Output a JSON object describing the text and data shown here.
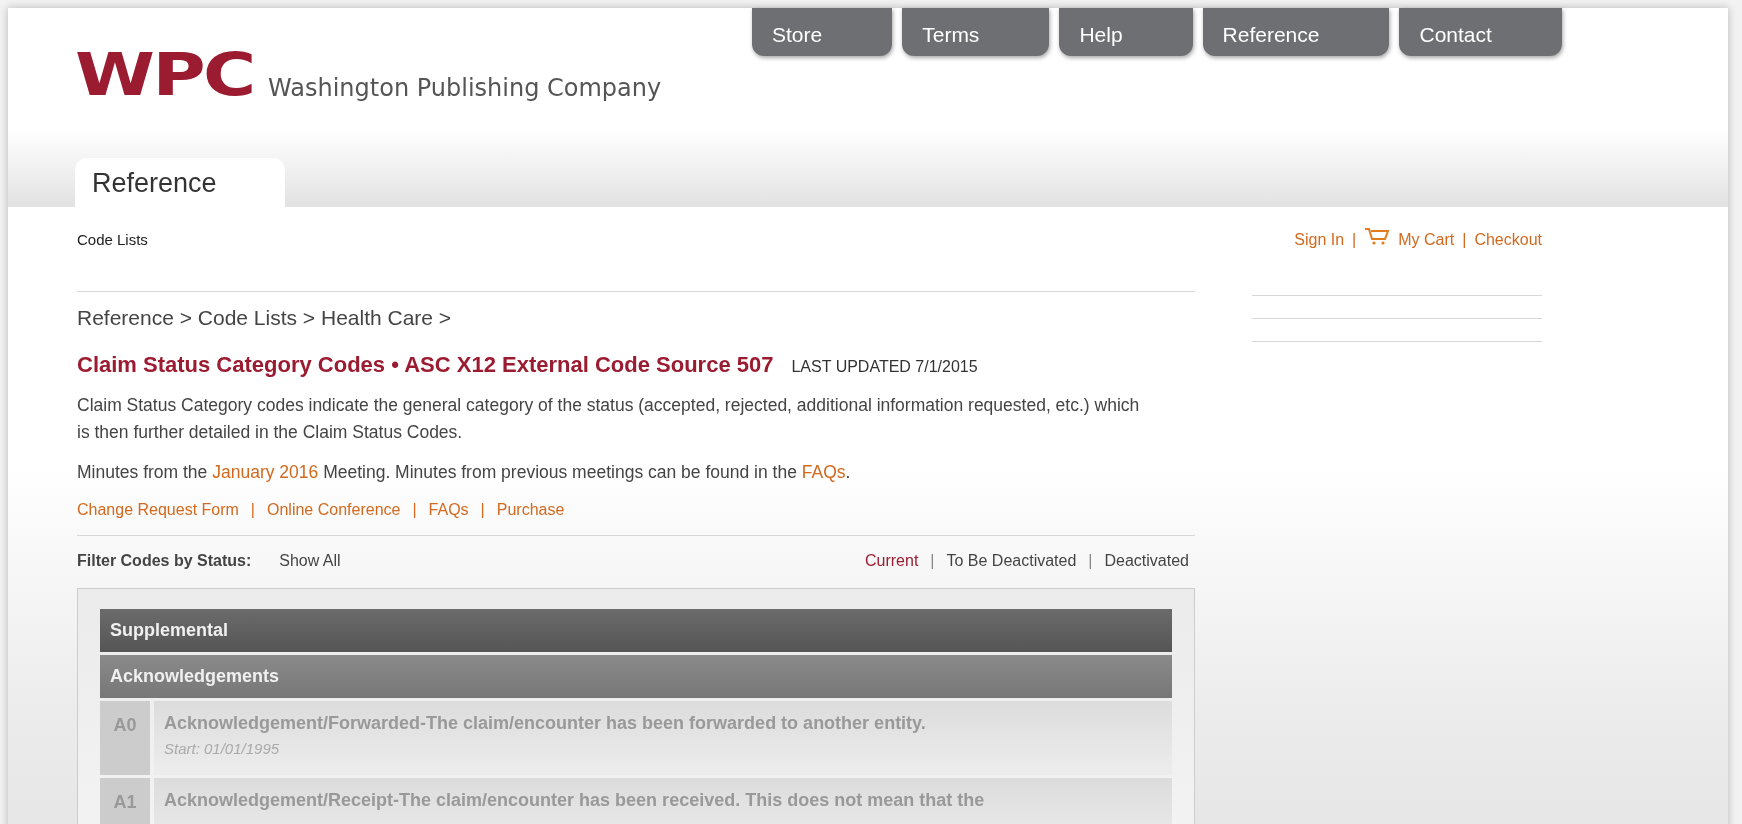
{
  "logo": {
    "mark": "WPC",
    "name": "Washington Publishing Company"
  },
  "nav": [
    {
      "label": "Store"
    },
    {
      "label": "Terms"
    },
    {
      "label": "Help"
    },
    {
      "label": "Reference"
    },
    {
      "label": "Contact"
    }
  ],
  "section_tab": "Reference",
  "subnav": "Code Lists",
  "account_separator": "|",
  "account_links": [
    {
      "label": "Sign In",
      "kind": "text"
    },
    {
      "label": "My Cart",
      "kind": "cart"
    },
    {
      "label": "Checkout",
      "kind": "text"
    }
  ],
  "breadcrumb": "Reference > Code Lists > Health Care >",
  "title": "Claim Status Category Codes • ASC X12 External Code Source 507",
  "last_updated": "LAST UPDATED 7/1/2015",
  "description": "Claim Status Category codes indicate the general category of the status (accepted, rejected, additional information requested, etc.) which is then further detailed in the Claim Status Codes.",
  "minutes": [
    {
      "text": "Minutes from the ",
      "kind": "text"
    },
    {
      "text": "January 2016",
      "kind": "link"
    },
    {
      "text": " Meeting. Minutes from previous meetings can be found in the ",
      "kind": "text"
    },
    {
      "text": "FAQs",
      "kind": "link"
    },
    {
      "text": ".",
      "kind": "text"
    }
  ],
  "links_separator": "|",
  "links": [
    "Change Request Form",
    "Online Conference",
    "FAQs",
    "Purchase"
  ],
  "filter": {
    "label": "Filter Codes by Status:",
    "show_all": "Show All",
    "separator": "|",
    "options": [
      {
        "label": "Current",
        "selected": true
      },
      {
        "label": "To Be Deactivated",
        "selected": false
      },
      {
        "label": "Deactivated",
        "selected": false
      }
    ]
  },
  "groups": [
    {
      "title": "Supplemental"
    },
    {
      "title": "Acknowledgements",
      "rows": [
        {
          "code": "A0",
          "text": "Acknowledgement/Forwarded-The claim/encounter has been forwarded to another entity.",
          "start": "Start: 01/01/1995"
        },
        {
          "code": "A1",
          "text": "Acknowledgement/Receipt-The claim/encounter has been received. This does not mean that the"
        }
      ]
    }
  ]
}
